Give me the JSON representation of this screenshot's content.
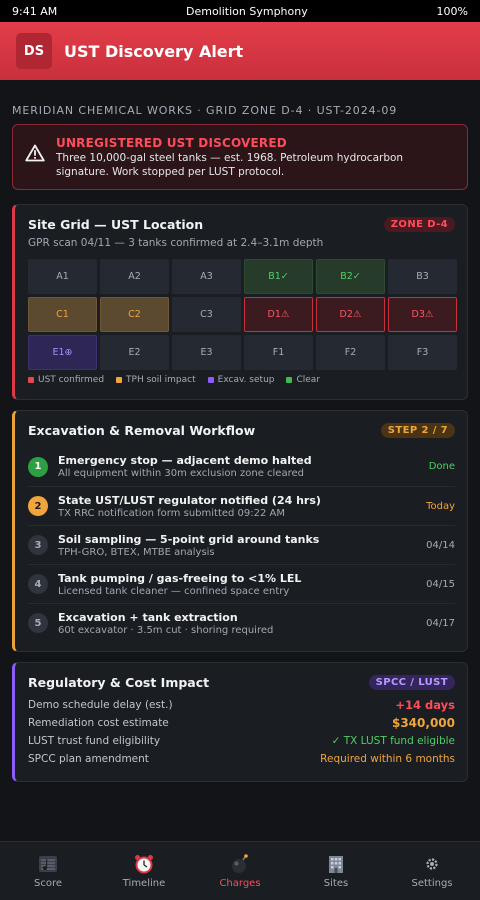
{
  "status_bar": {
    "time": "9:41 AM",
    "app_name": "Demolition Symphony",
    "battery": "100%"
  },
  "header": {
    "logo_text": "DS",
    "title": "UST Discovery Alert"
  },
  "breadcrumb": "MERIDIAN CHEMICAL WORKS · GRID ZONE D-4 · UST-2024-09",
  "alert": {
    "icon": "warning-triangle-icon",
    "title": "UNREGISTERED UST DISCOVERED",
    "body": "Three 10,000-gal steel tanks — est. 1968. Petroleum hydrocarbon signature. Work stopped per LUST protocol."
  },
  "site_grid": {
    "title": "Site Grid — UST Location",
    "badge": "ZONE D-4",
    "subtitle": "GPR scan 04/11 — 3 tanks confirmed at 2.4–3.1m depth",
    "cells": [
      {
        "label": "A1",
        "state": "normal"
      },
      {
        "label": "A2",
        "state": "normal"
      },
      {
        "label": "A3",
        "state": "normal"
      },
      {
        "label": "B1✓",
        "state": "clear"
      },
      {
        "label": "B2✓",
        "state": "clear"
      },
      {
        "label": "B3",
        "state": "normal"
      },
      {
        "label": "C1",
        "state": "tph"
      },
      {
        "label": "C2",
        "state": "tph"
      },
      {
        "label": "C3",
        "state": "normal"
      },
      {
        "label": "D1⚠",
        "state": "ust"
      },
      {
        "label": "D2⚠",
        "state": "ust"
      },
      {
        "label": "D3⚠",
        "state": "ust"
      },
      {
        "label": "E1⊕",
        "state": "excav"
      },
      {
        "label": "E2",
        "state": "normal"
      },
      {
        "label": "E3",
        "state": "normal"
      },
      {
        "label": "F1",
        "state": "normal"
      },
      {
        "label": "F2",
        "state": "normal"
      },
      {
        "label": "F3",
        "state": "normal"
      }
    ],
    "legend": [
      {
        "label": "UST confirmed",
        "color": "#e5484d"
      },
      {
        "label": "TPH soil impact",
        "color": "#f0a53d"
      },
      {
        "label": "Excav. setup",
        "color": "#8b5cf6"
      },
      {
        "label": "Clear",
        "color": "#3fb950"
      }
    ]
  },
  "workflow": {
    "title": "Excavation & Removal Workflow",
    "badge": "STEP 2 / 7",
    "steps": [
      {
        "num": "1",
        "title": "Emergency stop — adjacent demo halted",
        "desc": "All equipment within 30m exclusion zone cleared",
        "date": "Done",
        "status": "done"
      },
      {
        "num": "2",
        "title": "State UST/LUST regulator notified (24 hrs)",
        "desc": "TX RRC notification form submitted 09:22 AM",
        "date": "Today",
        "status": "active"
      },
      {
        "num": "3",
        "title": "Soil sampling — 5-point grid around tanks",
        "desc": "TPH-GRO, BTEX, MTBE analysis",
        "date": "04/14",
        "status": "pending"
      },
      {
        "num": "4",
        "title": "Tank pumping / gas-freeing to <1% LEL",
        "desc": "Licensed tank cleaner — confined space entry",
        "date": "04/15",
        "status": "pending"
      },
      {
        "num": "5",
        "title": "Excavation + tank extraction",
        "desc": "60t excavator · 3.5m cut · shoring required",
        "date": "04/17",
        "status": "pending"
      }
    ]
  },
  "regulatory": {
    "title": "Regulatory & Cost Impact",
    "badge": "SPCC / LUST",
    "rows": [
      {
        "label": "Demo schedule delay (est.)",
        "value": "+14 days",
        "tone": "red"
      },
      {
        "label": "Remediation cost estimate",
        "value": "$340,000",
        "tone": "amber"
      },
      {
        "label": "LUST trust fund eligibility",
        "value": "✓ TX LUST fund eligible",
        "tone": "green"
      },
      {
        "label": "SPCC plan amendment",
        "value": "Required within 6 months",
        "tone": "amb2"
      }
    ]
  },
  "tabs": [
    {
      "label": "Score",
      "icon": "music-score-icon",
      "active": false
    },
    {
      "label": "Timeline",
      "icon": "alarm-clock-icon",
      "active": false
    },
    {
      "label": "Charges",
      "icon": "bomb-icon",
      "active": true
    },
    {
      "label": "Sites",
      "icon": "building-icon",
      "active": false
    },
    {
      "label": "Settings",
      "icon": "gear-icon",
      "active": false
    }
  ]
}
